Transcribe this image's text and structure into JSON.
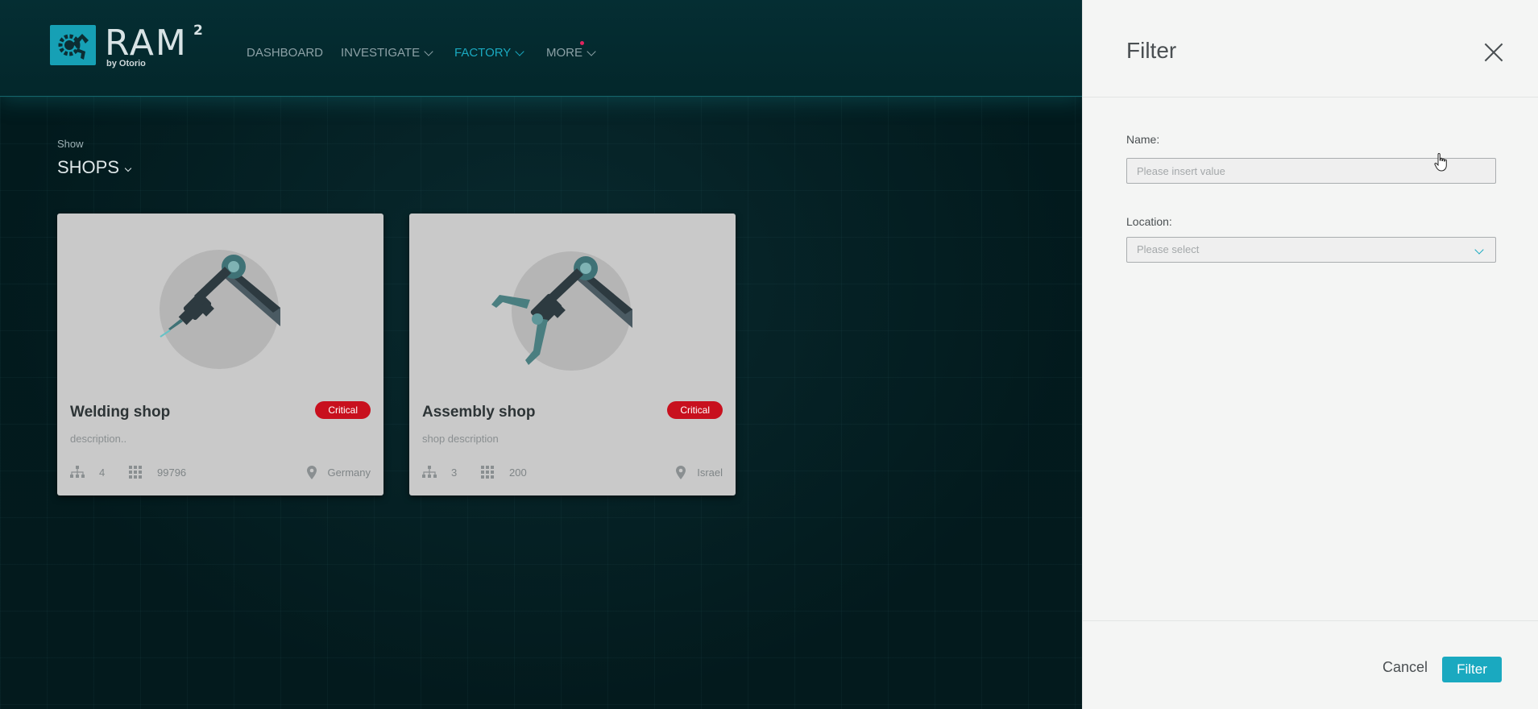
{
  "brand": {
    "name": "RAM",
    "superscript": "2",
    "tagline": "by Otorio",
    "accent": "#16a0b5"
  },
  "nav": {
    "items": [
      {
        "label": "DASHBOARD",
        "has_dropdown": false,
        "active": false
      },
      {
        "label": "INVESTIGATE",
        "has_dropdown": true,
        "active": false
      },
      {
        "label": "FACTORY",
        "has_dropdown": true,
        "active": true
      },
      {
        "label": "MORE",
        "has_dropdown": true,
        "active": false,
        "notification": true
      }
    ]
  },
  "view": {
    "show_label": "Show",
    "show_value": "SHOPS"
  },
  "shops": [
    {
      "name": "Welding shop",
      "status": "Critical",
      "description": "description..",
      "hierarchy_count": "4",
      "assets_count": "99796",
      "location": "Germany",
      "icon": "welding-robot-arm"
    },
    {
      "name": "Assembly shop",
      "status": "Critical",
      "description": "shop description",
      "hierarchy_count": "3",
      "assets_count": "200",
      "location": "Israel",
      "icon": "assembly-robot-arm"
    }
  ],
  "filter_panel": {
    "title": "Filter",
    "name_label": "Name:",
    "name_placeholder": "Please insert value",
    "name_value": "",
    "location_label": "Location:",
    "location_placeholder": "Please select",
    "cancel_label": "Cancel",
    "filter_label": "Filter"
  },
  "colors": {
    "critical": "#c8101e",
    "primary": "#1aa9c0",
    "background": "#041c1f"
  }
}
